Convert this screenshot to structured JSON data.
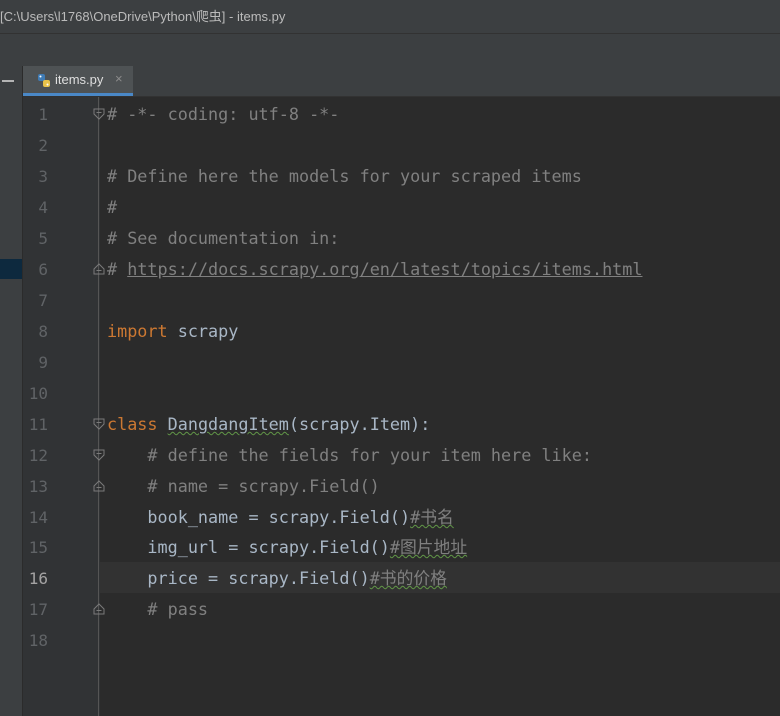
{
  "window": {
    "title": "[C:\\Users\\l1768\\OneDrive\\Python\\爬虫] - items.py"
  },
  "tab": {
    "label": "items.py",
    "close": "×"
  },
  "lines": [
    {
      "n": "1"
    },
    {
      "n": "2"
    },
    {
      "n": "3"
    },
    {
      "n": "4"
    },
    {
      "n": "5"
    },
    {
      "n": "6"
    },
    {
      "n": "7"
    },
    {
      "n": "8"
    },
    {
      "n": "9"
    },
    {
      "n": "10"
    },
    {
      "n": "11"
    },
    {
      "n": "12"
    },
    {
      "n": "13"
    },
    {
      "n": "14"
    },
    {
      "n": "15"
    },
    {
      "n": "16"
    },
    {
      "n": "17"
    },
    {
      "n": "18"
    }
  ],
  "code": {
    "l1": "# -*- coding: utf-8 -*-",
    "l3": "# Define here the models for your scraped items",
    "l4": "#",
    "l5": "# See documentation in:",
    "l6_hash": "# ",
    "l6_url": "https://docs.scrapy.org/en/latest/topics/items.html",
    "l8_kw": "import",
    "l8_rest": " scrapy",
    "l11_kw": "class",
    "l11_name": "DangdangItem",
    "l11_rest": "(scrapy.Item):",
    "l12": "    # define the fields for your item here like:",
    "l13": "    # name = scrapy.Field()",
    "l14_code": "    book_name = scrapy.Field()",
    "l14_comment": "#书名",
    "l15_code": "    img_url = scrapy.Field()",
    "l15_comment": "#图片地址",
    "l16_code": "    price = scrapy.Field()",
    "l16_comment": "#书的价格",
    "l17": "    # pass"
  },
  "active_line": "16",
  "colors": {
    "background": "#2b2b2b",
    "keyword": "#cc7832",
    "comment": "#808080",
    "text": "#a9b7c6",
    "tab_accent": "#4a88c7"
  }
}
